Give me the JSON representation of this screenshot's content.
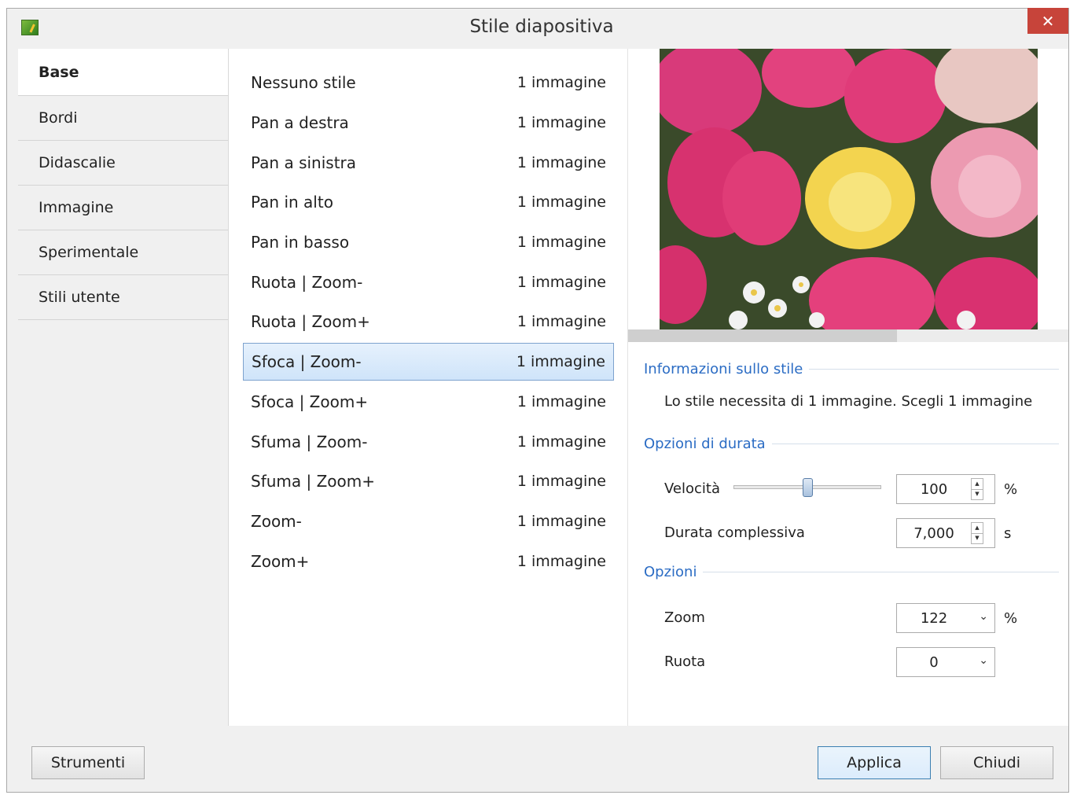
{
  "window": {
    "title": "Stile diapositiva",
    "close_glyph": "✕"
  },
  "sidebar": {
    "items": [
      {
        "label": "Base",
        "active": true
      },
      {
        "label": "Bordi"
      },
      {
        "label": "Didascalie"
      },
      {
        "label": "Immagine"
      },
      {
        "label": "Sperimentale"
      },
      {
        "label": "Stili utente"
      }
    ]
  },
  "styles": {
    "rows": [
      {
        "name": "Nessuno stile",
        "count": "1 immagine"
      },
      {
        "name": "Pan a destra",
        "count": "1 immagine"
      },
      {
        "name": "Pan a sinistra",
        "count": "1 immagine"
      },
      {
        "name": "Pan in alto",
        "count": "1 immagine"
      },
      {
        "name": "Pan in basso",
        "count": "1 immagine"
      },
      {
        "name": "Ruota | Zoom-",
        "count": "1 immagine"
      },
      {
        "name": "Ruota | Zoom+",
        "count": "1 immagine"
      },
      {
        "name": "Sfoca | Zoom-",
        "count": "1 immagine",
        "selected": true
      },
      {
        "name": "Sfoca | Zoom+",
        "count": "1 immagine"
      },
      {
        "name": "Sfuma | Zoom-",
        "count": "1 immagine"
      },
      {
        "name": "Sfuma | Zoom+",
        "count": "1 immagine"
      },
      {
        "name": "Zoom-",
        "count": "1 immagine"
      },
      {
        "name": "Zoom+",
        "count": "1 immagine"
      }
    ]
  },
  "preview": {
    "progress": 0.61
  },
  "info": {
    "section_title": "Informazioni sullo stile",
    "text": "Lo stile necessita di 1 immagine. Scegli 1 immagine"
  },
  "duration": {
    "section_title": "Opzioni di durata",
    "speed_label": "Velocità",
    "speed_value": "100",
    "speed_unit": "%",
    "speed_slider": 0.5,
    "total_label": "Durata complessiva",
    "total_value": "7,000",
    "total_unit": "s"
  },
  "options": {
    "section_title": "Opzioni",
    "zoom_label": "Zoom",
    "zoom_value": "122",
    "zoom_unit": "%",
    "rotate_label": "Ruota",
    "rotate_value": "0"
  },
  "buttons": {
    "tools": "Strumenti",
    "apply": "Applica",
    "close": "Chiudi"
  },
  "icons": {
    "app": "app-logo-icon",
    "close": "close-icon",
    "spin_up": "spin-up-icon",
    "spin_down": "spin-down-icon",
    "dropdown": "chevron-down-icon"
  }
}
